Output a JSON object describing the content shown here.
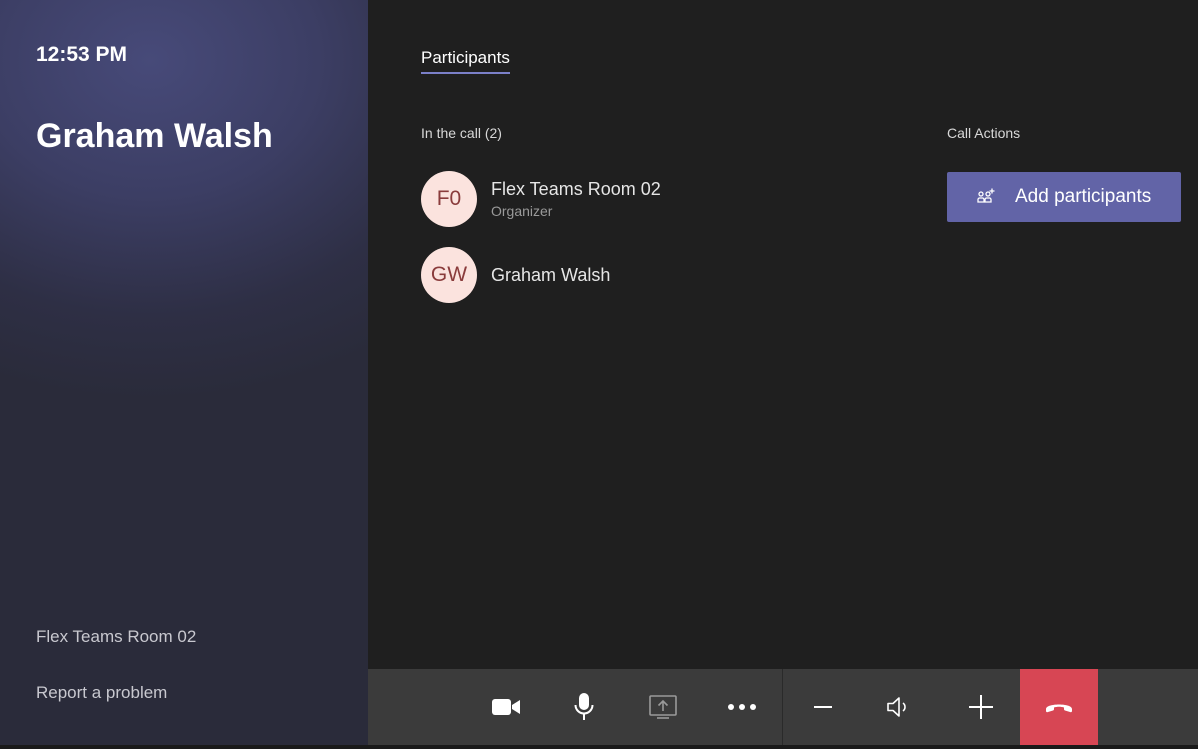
{
  "left_panel": {
    "time": "12:53 PM",
    "caller_name": "Graham Walsh",
    "room_name": "Flex Teams Room 02",
    "report_link": "Report a problem"
  },
  "main": {
    "tab_label": "Participants",
    "in_call_heading": "In the call (2)",
    "call_actions_heading": "Call Actions",
    "add_participants_label": "Add participants",
    "participants": [
      {
        "initials": "F0",
        "name": "Flex Teams Room 02",
        "role": "Organizer"
      },
      {
        "initials": "GW",
        "name": "Graham Walsh",
        "role": ""
      }
    ]
  },
  "controls": [
    {
      "icon": "video-camera-icon"
    },
    {
      "icon": "microphone-icon"
    },
    {
      "icon": "share-screen-icon"
    },
    {
      "icon": "more-options-icon"
    },
    {
      "icon": "volume-down-icon"
    },
    {
      "icon": "speaker-icon"
    },
    {
      "icon": "volume-up-icon"
    },
    {
      "icon": "hang-up-icon"
    }
  ],
  "colors": {
    "accent": "#6264a7",
    "hangup": "#d74654",
    "avatar_bg": "#fbe3de",
    "avatar_text": "#8a3c3c"
  }
}
